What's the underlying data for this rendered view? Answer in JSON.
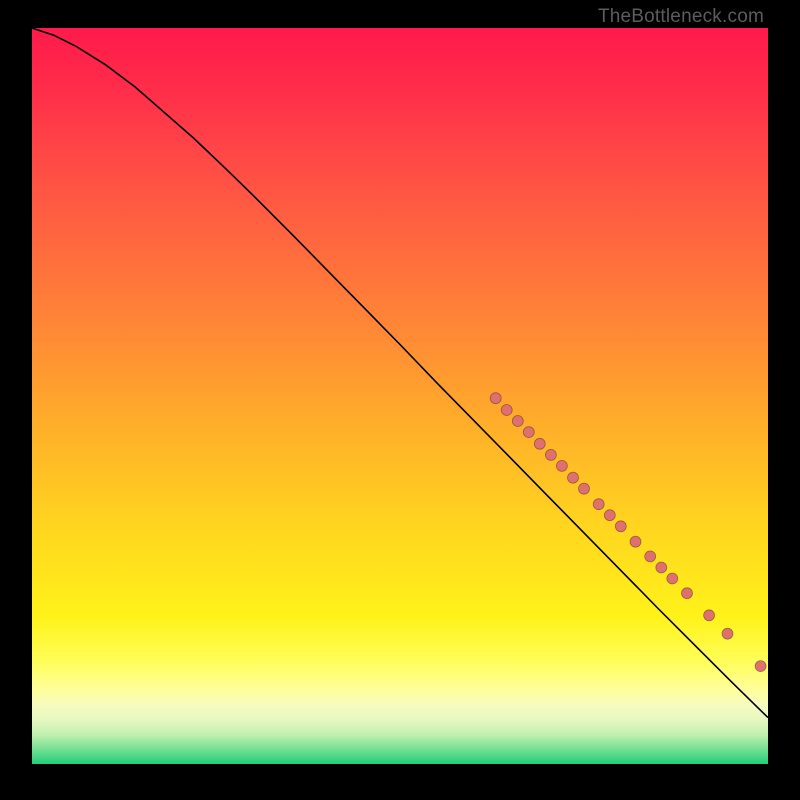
{
  "watermark": "TheBottleneck.com",
  "chart_data": {
    "type": "line",
    "title": "",
    "xlabel": "",
    "ylabel": "",
    "xlim": [
      0,
      100
    ],
    "ylim": [
      0,
      100
    ],
    "grid": false,
    "background_gradient": [
      "#ff1a4b",
      "#ffd61f",
      "#fffe58",
      "#1fcf7a"
    ],
    "series": [
      {
        "name": "curve",
        "x": [
          0,
          3,
          6,
          10,
          14,
          18,
          22,
          26,
          30,
          35,
          40,
          45,
          50,
          55,
          60,
          65,
          70,
          75,
          80,
          85,
          90,
          95,
          100
        ],
        "y": [
          100,
          99,
          97.5,
          95,
          92,
          88.5,
          85,
          81.2,
          77.3,
          72.3,
          67.2,
          62.1,
          57,
          51.8,
          46.7,
          41.6,
          36.5,
          31.4,
          26.3,
          21.2,
          16.2,
          11.2,
          6.3
        ]
      }
    ],
    "points": [
      {
        "x": 63,
        "y": 49.7
      },
      {
        "x": 64.5,
        "y": 48.1
      },
      {
        "x": 66,
        "y": 46.6
      },
      {
        "x": 67.5,
        "y": 45.1
      },
      {
        "x": 69,
        "y": 43.5
      },
      {
        "x": 70.5,
        "y": 42.0
      },
      {
        "x": 72,
        "y": 40.5
      },
      {
        "x": 73.5,
        "y": 38.9
      },
      {
        "x": 75,
        "y": 37.4
      },
      {
        "x": 77,
        "y": 35.3
      },
      {
        "x": 78.5,
        "y": 33.8
      },
      {
        "x": 80,
        "y": 32.3
      },
      {
        "x": 82,
        "y": 30.2
      },
      {
        "x": 84,
        "y": 28.2
      },
      {
        "x": 85.5,
        "y": 26.7
      },
      {
        "x": 87,
        "y": 25.2
      },
      {
        "x": 89,
        "y": 23.2
      },
      {
        "x": 92,
        "y": 20.2
      },
      {
        "x": 94.5,
        "y": 17.7
      },
      {
        "x": 99,
        "y": 13.3
      }
    ]
  }
}
